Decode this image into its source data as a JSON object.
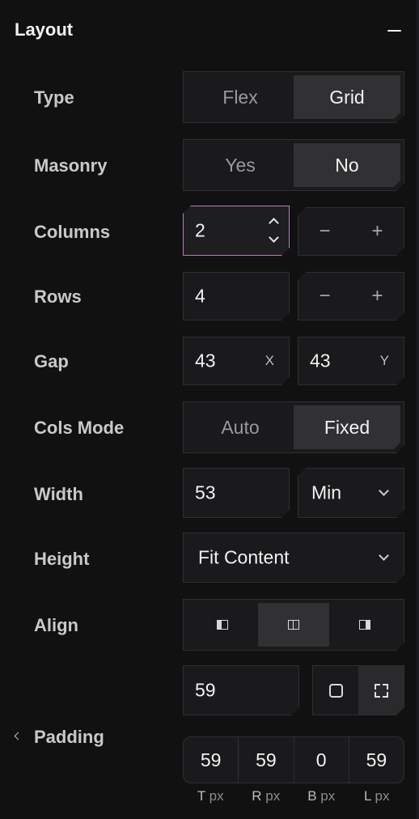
{
  "header": {
    "title": "Layout"
  },
  "type": {
    "label": "Type",
    "options": [
      "Flex",
      "Grid"
    ],
    "selected": "Grid"
  },
  "masonry": {
    "label": "Masonry",
    "options": [
      "Yes",
      "No"
    ],
    "selected": "No"
  },
  "columns": {
    "label": "Columns",
    "value": "2",
    "minus": "−",
    "plus": "+"
  },
  "rows": {
    "label": "Rows",
    "value": "4",
    "minus": "−",
    "plus": "+"
  },
  "gap": {
    "label": "Gap",
    "x_value": "43",
    "x_suffix": "X",
    "y_value": "43",
    "y_suffix": "Y"
  },
  "cols_mode": {
    "label": "Cols Mode",
    "options": [
      "Auto",
      "Fixed"
    ],
    "selected": "Fixed"
  },
  "width": {
    "label": "Width",
    "value": "53",
    "unit": "Min"
  },
  "height": {
    "label": "Height",
    "value": "Fit Content"
  },
  "align": {
    "label": "Align",
    "options": [
      "align-left-icon",
      "align-center-icon",
      "align-right-icon"
    ],
    "selected": "align-center-icon"
  },
  "padding": {
    "label": "Padding",
    "all_value": "59",
    "mode_options": [
      "square-icon",
      "corners-icon"
    ],
    "selected_mode": "corners-icon",
    "sides": [
      {
        "value": "59",
        "letter": "T",
        "unit": "px"
      },
      {
        "value": "59",
        "letter": "R",
        "unit": "px"
      },
      {
        "value": "0",
        "letter": "B",
        "unit": "px"
      },
      {
        "value": "59",
        "letter": "L",
        "unit": "px"
      }
    ]
  },
  "colors": {
    "background": "#111112",
    "field": "#1a1a1c",
    "active": "#313134",
    "focus_border": "#b780b5"
  }
}
